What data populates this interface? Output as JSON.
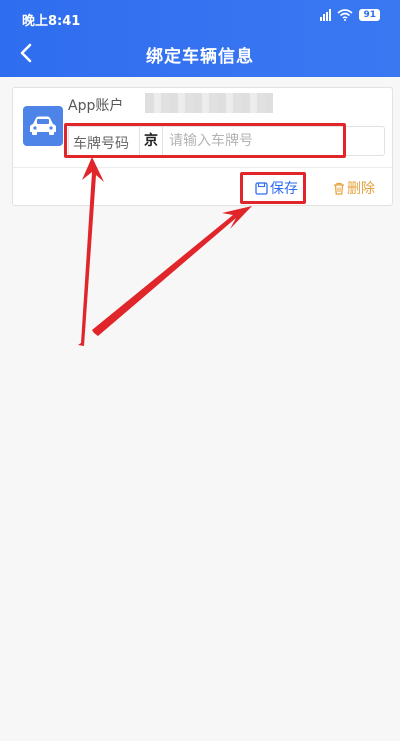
{
  "status_bar": {
    "time": "晚上8:41",
    "battery": "91"
  },
  "header": {
    "title": "绑定车辆信息"
  },
  "icons": {
    "back": "chevron-left-icon",
    "car": "car-icon",
    "save": "save-icon",
    "delete": "trash-icon"
  },
  "card": {
    "account_label": "App账户",
    "plate_label": "车牌号码",
    "plate_prefix": "京",
    "plate_placeholder": "请输入车牌号",
    "save_label": "保存",
    "delete_label": "删除"
  },
  "colors": {
    "primary": "#2f6df0",
    "car_icon_bg": "#4e84e8",
    "delete": "#e6a23c",
    "annotation": "#e0262a"
  }
}
